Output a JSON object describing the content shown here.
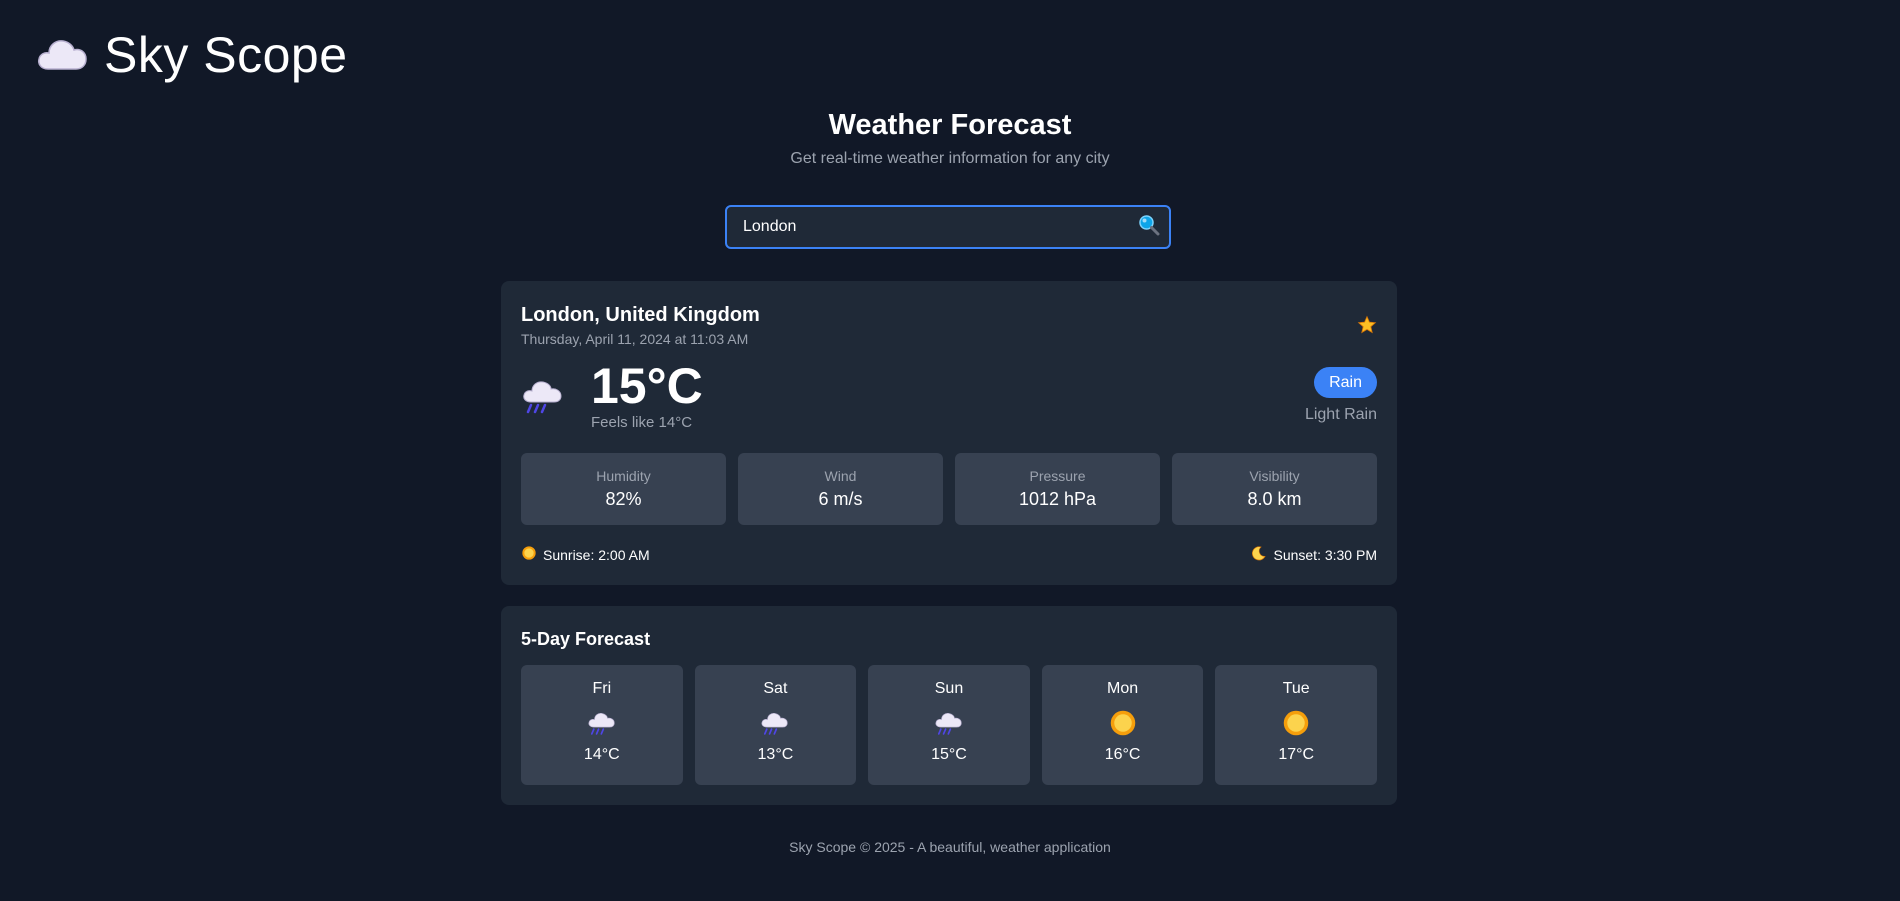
{
  "brand": {
    "title": "Sky Scope"
  },
  "hero": {
    "title": "Weather Forecast",
    "subtitle": "Get real-time weather information for any city"
  },
  "search": {
    "value": "London"
  },
  "current": {
    "location": "London, United Kingdom",
    "datetime": "Thursday, April 11, 2024 at 11:03 AM",
    "temperature": "15°C",
    "feels_like": "Feels like 14°C",
    "condition": "Rain",
    "description": "Light Rain",
    "icon": "rain-cloud-icon",
    "stats": [
      {
        "label": "Humidity",
        "value": "82%"
      },
      {
        "label": "Wind",
        "value": "6 m/s"
      },
      {
        "label": "Pressure",
        "value": "1012 hPa"
      },
      {
        "label": "Visibility",
        "value": "8.0 km"
      }
    ],
    "sunrise": "Sunrise: 2:00 AM",
    "sunset": "Sunset: 3:30 PM"
  },
  "forecast": {
    "title": "5-Day Forecast",
    "days": [
      {
        "day": "Fri",
        "icon": "rain-cloud-icon",
        "temp": "14°C"
      },
      {
        "day": "Sat",
        "icon": "rain-cloud-icon",
        "temp": "13°C"
      },
      {
        "day": "Sun",
        "icon": "rain-cloud-icon",
        "temp": "15°C"
      },
      {
        "day": "Mon",
        "icon": "sun-icon",
        "temp": "16°C"
      },
      {
        "day": "Tue",
        "icon": "sun-icon",
        "temp": "17°C"
      }
    ]
  },
  "footer": {
    "text": "Sky Scope © 2025 - A beautiful, weather application"
  },
  "colors": {
    "background": "#111827",
    "card": "#1f2937",
    "tile": "#374151",
    "accent": "#3b82f6",
    "star": "#fbbf24"
  }
}
